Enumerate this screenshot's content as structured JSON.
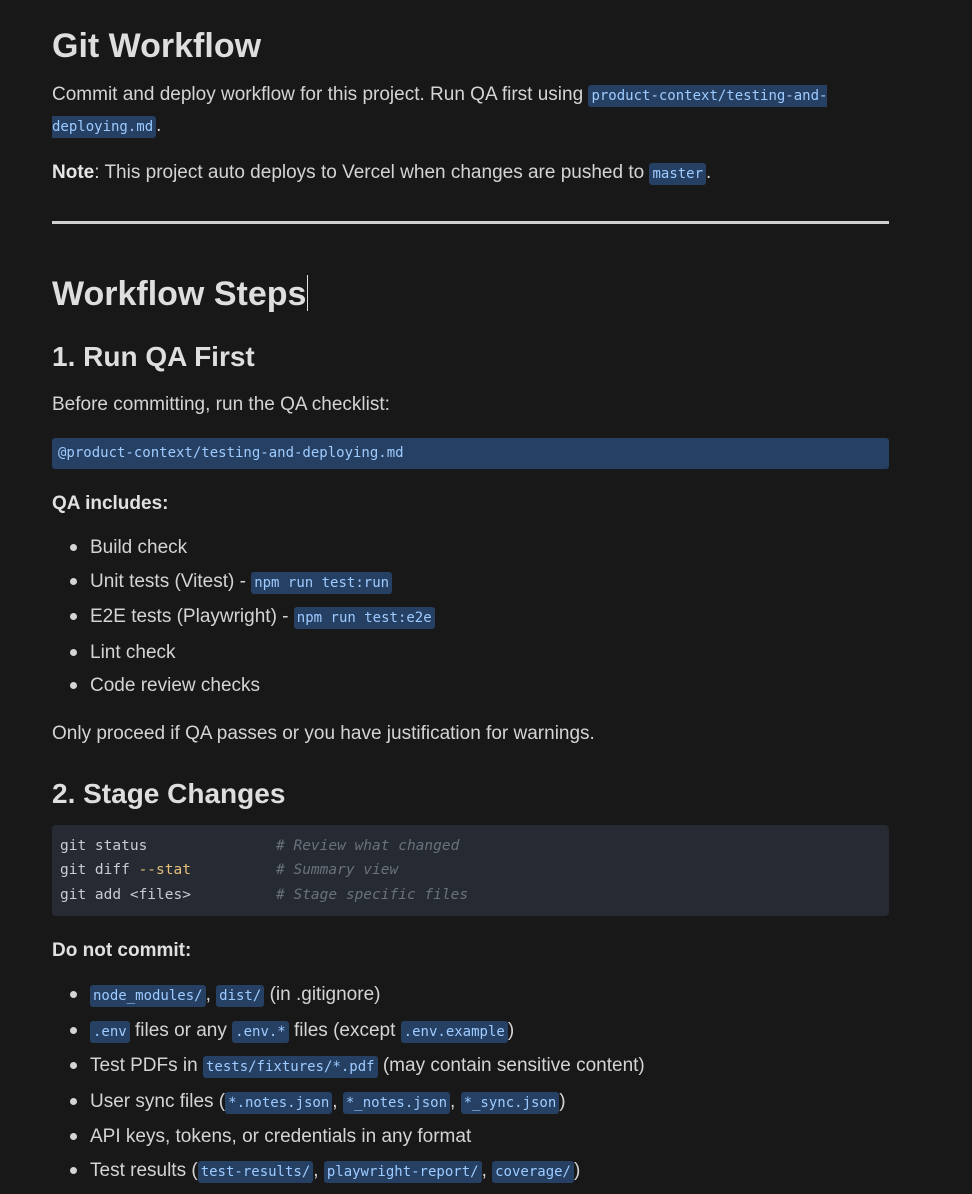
{
  "title": "Git Workflow",
  "intro": {
    "text_before": "Commit and deploy workflow for this project. Run QA first using ",
    "code": "product-context/testing-and-deploying.md",
    "text_after": "."
  },
  "note": {
    "label": "Note",
    "text": ": This project auto deploys to Vercel when changes are pushed to ",
    "code": "master",
    "text_after": "."
  },
  "workflow_heading": "Workflow Steps",
  "step1": {
    "heading": "1. Run QA First",
    "intro": "Before committing, run the QA checklist:",
    "path": "@product-context/testing-and-deploying.md",
    "includes_label": "QA includes:",
    "items": [
      {
        "text": "Build check",
        "sep": "",
        "code": ""
      },
      {
        "text": "Unit tests (Vitest)",
        "sep": " - ",
        "code": "npm run test:run"
      },
      {
        "text": "E2E tests (Playwright)",
        "sep": " - ",
        "code": "npm run test:e2e"
      },
      {
        "text": "Lint check",
        "sep": "",
        "code": ""
      },
      {
        "text": "Code review checks",
        "sep": "",
        "code": ""
      }
    ],
    "after": "Only proceed if QA passes or you have justification for warnings."
  },
  "step2": {
    "heading": "2. Stage Changes",
    "code_lines": [
      {
        "cmd": "git status",
        "flag": "",
        "comment": "# Review what changed"
      },
      {
        "cmd": "git diff ",
        "flag": "--stat",
        "comment": "# Summary view"
      },
      {
        "cmd": "git add <files>",
        "flag": "",
        "comment": "# Stage specific files"
      }
    ],
    "do_not_label": "Do not commit:",
    "do_not_items": {
      "i1": {
        "c1": "node_modules/",
        "s1": ", ",
        "c2": "dist/",
        "t1": " (in .gitignore)"
      },
      "i2": {
        "c1": ".env",
        "t1": " files or any ",
        "c2": ".env.*",
        "t2": " files (except ",
        "c3": ".env.example",
        "t3": ")"
      },
      "i3": {
        "t0": "Test PDFs in ",
        "c1": "tests/fixtures/*.pdf",
        "t1": " (may contain sensitive content)"
      },
      "i4": {
        "t0": "User sync files (",
        "c1": "*.notes.json",
        "s1": ", ",
        "c2": "*_notes.json",
        "s2": ", ",
        "c3": "*_sync.json",
        "t1": ")"
      },
      "i5": {
        "t0": "API keys, tokens, or credentials in any format"
      },
      "i6": {
        "t0": "Test results (",
        "c1": "test-results/",
        "s1": ", ",
        "c2": "playwright-report/",
        "s2": ", ",
        "c3": "coverage/",
        "t1": ")"
      }
    }
  },
  "colors": {
    "background": "#181818",
    "inline_code_bg": "#264064",
    "inline_code_text": "#9ecbff",
    "code_block_bg": "#262a33"
  }
}
